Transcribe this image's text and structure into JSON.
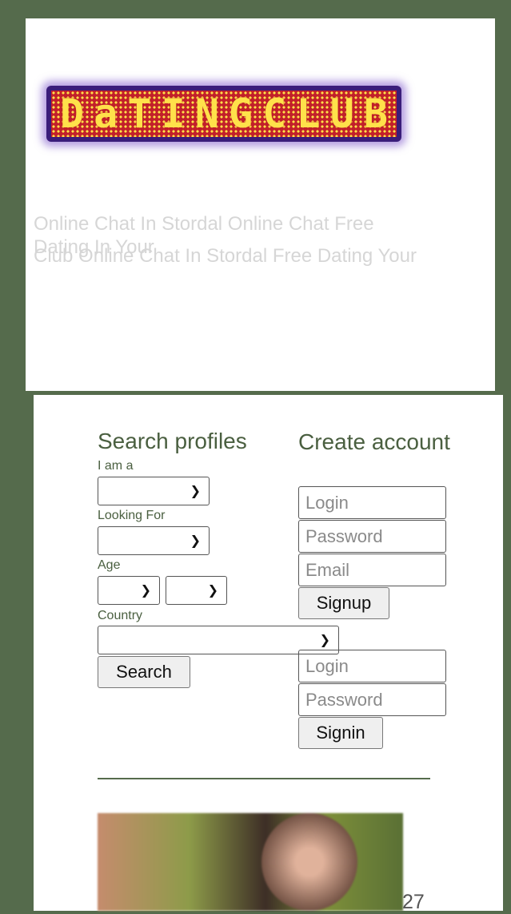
{
  "logo": {
    "letters": [
      "D",
      "a",
      "T",
      "I",
      "N",
      "G",
      "C",
      "L",
      "U",
      "B"
    ]
  },
  "headline": {
    "line1": "Online Chat In Stordal Online Chat Free",
    "line2a": "Dating In Your",
    "line2b": "Club Online Chat In Stordal Free Dating Your"
  },
  "search": {
    "title": "Search profiles",
    "i_am_label": "I am a",
    "looking_for_label": "Looking For",
    "age_label": "Age",
    "country_label": "Country",
    "search_button": "Search"
  },
  "create": {
    "title": "Create account",
    "login_placeholder": "Login",
    "password_placeholder": "Password",
    "email_placeholder": "Email",
    "signup_button": "Signup"
  },
  "signin": {
    "login_placeholder": "Login",
    "password_placeholder": "Password",
    "signin_button": "Signin"
  },
  "profile": {
    "age": "27"
  },
  "colors": {
    "background": "#556b4c",
    "panel": "#ffffff",
    "accent_text": "#4a5f40"
  }
}
